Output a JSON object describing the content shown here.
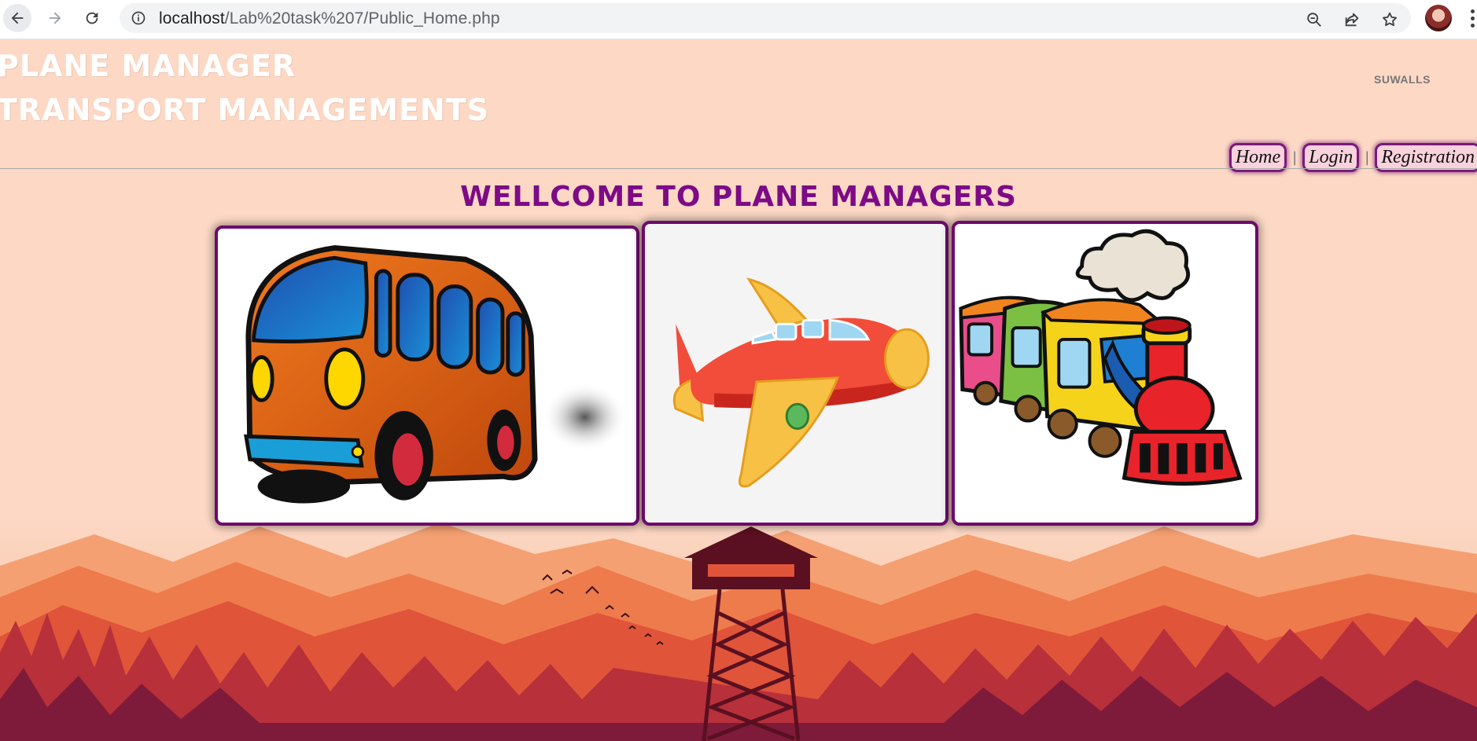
{
  "browser": {
    "url_host": "localhost",
    "url_path": "/Lab%20task%207/Public_Home.php"
  },
  "header": {
    "brand_line1": "PLANE MANAGER",
    "brand_line2": "TRANSPORT MANAGEMENTS",
    "user_label": "SUWALLS"
  },
  "nav": {
    "home": "Home",
    "login": "Login",
    "registration": "Registration",
    "separator": "|"
  },
  "main": {
    "welcome": "WELLCOME TO PLANE MANAGERS",
    "cards": [
      "bus",
      "plane",
      "train"
    ]
  },
  "colors": {
    "page_bg": "#fcd8c5",
    "accent": "#7d0a86",
    "card_border": "#6d0a6d"
  }
}
